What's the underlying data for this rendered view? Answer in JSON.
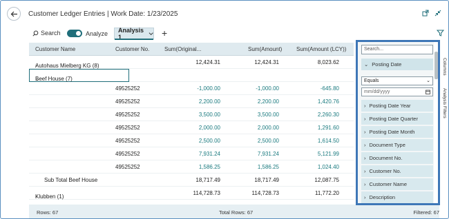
{
  "title": "Customer Ledger Entries | Work Date: 1/23/2025",
  "toolbar": {
    "search_label": "Search",
    "analyze_label": "Analyze",
    "tab_label": "Analysis 1"
  },
  "grid": {
    "headers": [
      "Customer Name",
      "Customer No.",
      "Sum(Original...",
      "Sum(Amount)",
      "Sum(Amount (LCY))"
    ],
    "rows": [
      {
        "name": "Autohaus Mielberg KG (8)",
        "no": "",
        "orig": "12,424.31",
        "amt": "12,424.31",
        "lcy": "8,023.62",
        "type": "group"
      },
      {
        "name": "Beef House (7)",
        "no": "",
        "orig": "",
        "amt": "",
        "lcy": "",
        "type": "group-open"
      },
      {
        "name": "",
        "no": "49525252",
        "orig": "-1,000.00",
        "amt": "-1,000.00",
        "lcy": "-645.80",
        "type": "detail"
      },
      {
        "name": "",
        "no": "49525252",
        "orig": "2,200.00",
        "amt": "2,200.00",
        "lcy": "1,420.76",
        "type": "detail"
      },
      {
        "name": "",
        "no": "49525252",
        "orig": "3,500.00",
        "amt": "3,500.00",
        "lcy": "2,260.30",
        "type": "detail"
      },
      {
        "name": "",
        "no": "49525252",
        "orig": "2,000.00",
        "amt": "2,000.00",
        "lcy": "1,291.60",
        "type": "detail"
      },
      {
        "name": "",
        "no": "49525252",
        "orig": "2,500.00",
        "amt": "2,500.00",
        "lcy": "1,614.50",
        "type": "detail"
      },
      {
        "name": "",
        "no": "49525252",
        "orig": "7,931.24",
        "amt": "7,931.24",
        "lcy": "5,121.99",
        "type": "detail"
      },
      {
        "name": "",
        "no": "49525252",
        "orig": "1,586.25",
        "amt": "1,586.25",
        "lcy": "1,024.40",
        "type": "detail"
      },
      {
        "name": "Sub Total Beef House",
        "no": "",
        "orig": "18,717.49",
        "amt": "18,717.49",
        "lcy": "12,087.75",
        "type": "subtotal"
      },
      {
        "name": "Klubben (1)",
        "no": "",
        "orig": "114,728.73",
        "amt": "114,728.73",
        "lcy": "11,772.20",
        "type": "group"
      }
    ]
  },
  "status": {
    "rows": "Rows: 67",
    "total_rows": "Total Rows: 67",
    "filtered": "Filtered: 67"
  },
  "filter_pane": {
    "search_placeholder": "Search...",
    "posting_date": "Posting Date",
    "operator": "Equals",
    "date_placeholder": "mm/dd/yyyy",
    "items": [
      "Posting Date Year",
      "Posting Date Quarter",
      "Posting Date Month",
      "Document Type",
      "Document No.",
      "Customer No.",
      "Customer Name",
      "Description"
    ],
    "tab_columns": "Columns",
    "tab_filters": "Analysis Filters"
  },
  "colors": {
    "accent": "#1f6e7a",
    "header_bg": "#dfeaef",
    "pane_border": "#3e77b7",
    "amount_teal": "#1a7a7f"
  }
}
